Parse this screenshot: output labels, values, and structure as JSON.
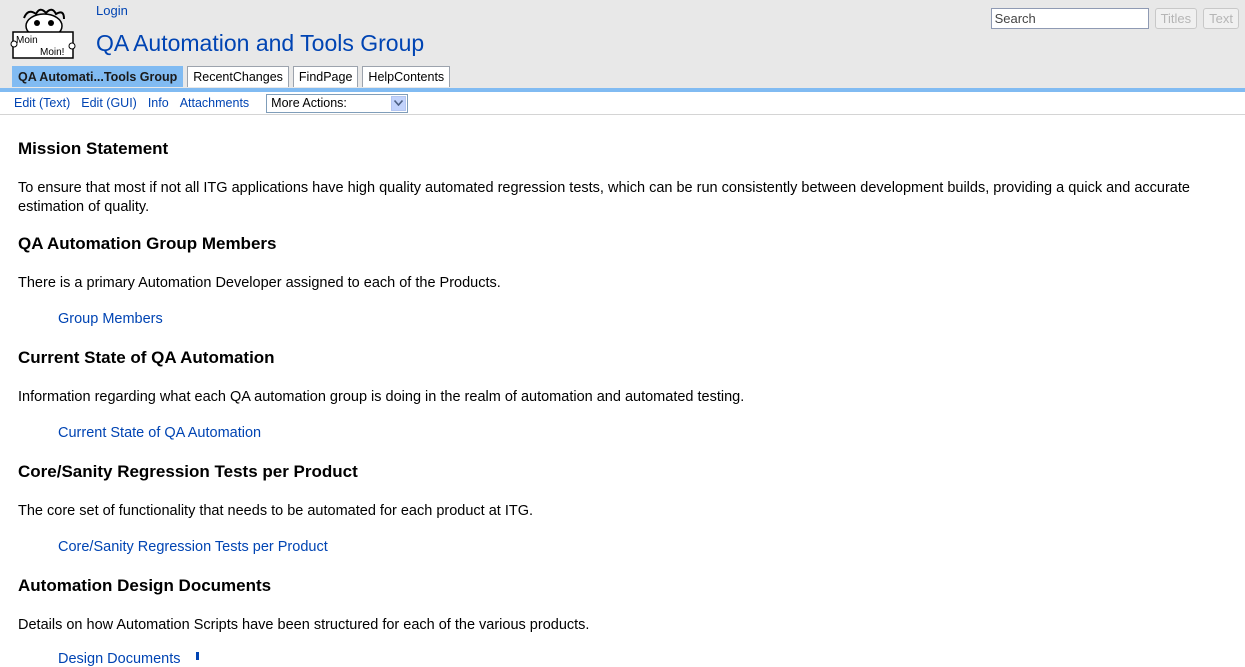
{
  "header": {
    "login_label": "Login",
    "title": "QA Automation and Tools Group",
    "logo_text_top": "Moin",
    "logo_text_bottom": "Moin!"
  },
  "search": {
    "placeholder": "Search",
    "titles_label": "Titles",
    "text_label": "Text"
  },
  "navibar": {
    "tabs": [
      {
        "label": "QA Automati...Tools Group",
        "current": true
      },
      {
        "label": "RecentChanges",
        "current": false
      },
      {
        "label": "FindPage",
        "current": false
      },
      {
        "label": "HelpContents",
        "current": false
      }
    ]
  },
  "editbar": {
    "links": [
      "Edit (Text)",
      "Edit (GUI)",
      "Info",
      "Attachments"
    ],
    "more_actions": "More Actions:"
  },
  "sections": [
    {
      "heading": "Mission Statement",
      "text": "To ensure that most if not all ITG applications have high quality automated regression tests, which can be run consistently between development builds, providing a quick and accurate estimation of quality.",
      "link": ""
    },
    {
      "heading": "QA Automation Group Members",
      "text": "There is a primary Automation Developer assigned to each of the Products.",
      "link": "Group Members"
    },
    {
      "heading": "Current State of QA Automation",
      "text": "Information regarding what each QA automation group is doing in the realm of automation and automated testing.",
      "link": "Current State of QA Automation"
    },
    {
      "heading": "Core/Sanity Regression Tests per Product",
      "text": "The core set of functionality that needs to be automated for each product at ITG.",
      "link": "Core/Sanity Regression Tests per Product"
    },
    {
      "heading": "Automation Design Documents",
      "text": "Details on how Automation Scripts have been structured for each of the various products.",
      "link": "Design Documents"
    }
  ],
  "colors": {
    "link": "#0044b3",
    "tab_active": "#81bbf2",
    "header_bg": "#e8e8e8"
  }
}
